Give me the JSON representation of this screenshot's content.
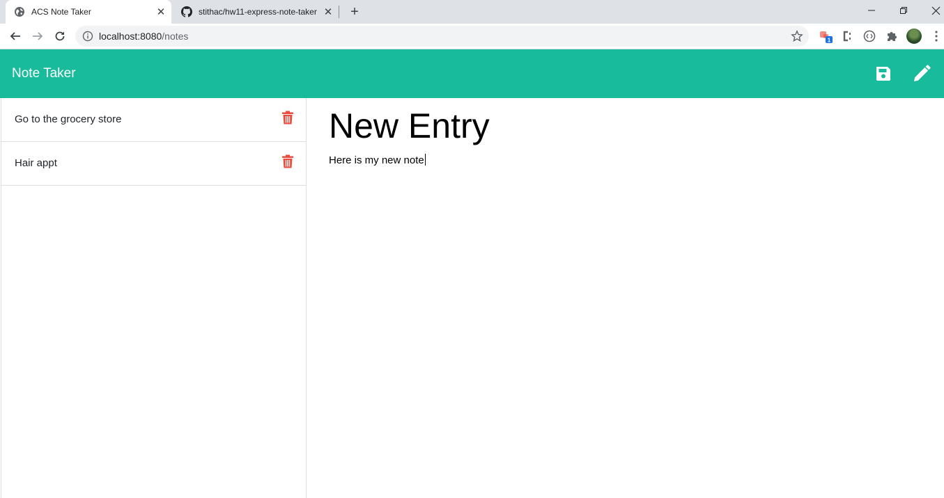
{
  "browser": {
    "tabs": [
      {
        "title": "ACS Note Taker",
        "icon": "globe-icon",
        "active": true
      },
      {
        "title": "stithac/hw11-express-note-taker",
        "icon": "github-icon",
        "active": false
      }
    ],
    "url_host": "localhost:8080",
    "url_path": "/notes"
  },
  "app": {
    "title": "Note Taker",
    "accent_color": "#18bc9c",
    "delete_color": "#e74c3c"
  },
  "notes": [
    {
      "title": "Go to the grocery store"
    },
    {
      "title": "Hair appt"
    }
  ],
  "editor": {
    "title": "New Entry",
    "body": "Here is my new note"
  }
}
